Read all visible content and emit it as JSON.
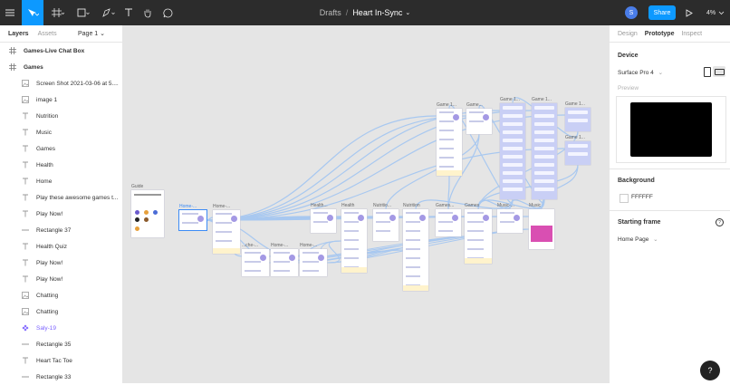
{
  "toolbar": {
    "breadcrumb_project": "Drafts",
    "breadcrumb_sep": "/",
    "file_name": "Heart In-Sync",
    "file_caret": "⌄",
    "avatar_letter": "S",
    "share_label": "Share",
    "zoom_label": "4%"
  },
  "left_panel": {
    "tab_layers": "Layers",
    "tab_assets": "Assets",
    "page_selector": "Page 1 ⌄",
    "layers": [
      {
        "name": "Games-Live Chat Box",
        "type": "frame",
        "level": 0
      },
      {
        "name": "Games",
        "type": "frame",
        "level": 0
      },
      {
        "name": "Screen Shot 2021-03-06 at 5....",
        "type": "image",
        "level": 1
      },
      {
        "name": "image 1",
        "type": "image",
        "level": 1
      },
      {
        "name": "Nutrition",
        "type": "text",
        "level": 1
      },
      {
        "name": "Music",
        "type": "text",
        "level": 1
      },
      {
        "name": "Games",
        "type": "text",
        "level": 1
      },
      {
        "name": "Health",
        "type": "text",
        "level": 1
      },
      {
        "name": "Home",
        "type": "text",
        "level": 1
      },
      {
        "name": "Play these awesome games t...",
        "type": "text",
        "level": 1
      },
      {
        "name": "Play Now!",
        "type": "text",
        "level": 1
      },
      {
        "name": "Rectangle 37",
        "type": "rect",
        "level": 1
      },
      {
        "name": "Health Quiz",
        "type": "text",
        "level": 1
      },
      {
        "name": "Play Now!",
        "type": "text",
        "level": 1
      },
      {
        "name": "Play Now!",
        "type": "text",
        "level": 1
      },
      {
        "name": "Chatting",
        "type": "image",
        "level": 1
      },
      {
        "name": "Chatting",
        "type": "image",
        "level": 1
      },
      {
        "name": "Saly-19",
        "type": "component",
        "level": 1
      },
      {
        "name": "Rectangle 35",
        "type": "rect",
        "level": 1
      },
      {
        "name": "Heart Tac Toe",
        "type": "text",
        "level": 1
      },
      {
        "name": "Rectangle 33",
        "type": "rect",
        "level": 1
      }
    ]
  },
  "canvas": {
    "frame_labels": [
      "Guide",
      "Home-...",
      "Home-...",
      "Health...",
      "Health",
      "Nutritio...",
      "Nutrition",
      "Games...",
      "Games",
      "Music-...",
      "Music",
      "Game 1...",
      "Game...",
      "Game 1...",
      "Game 1...",
      "Game 1...",
      "Game 1...",
      "...che-...",
      "Home-...",
      "Home-..."
    ],
    "colors": {
      "canvas_bg": "#e5e5e5",
      "connector": "#a8c8f0",
      "selection": "#3c8bf5",
      "hotspot": "#e4e8ff"
    }
  },
  "right_panel": {
    "tab_design": "Design",
    "tab_prototype": "Prototype",
    "tab_inspect": "Inspect",
    "device_title": "Device",
    "device_value": "Surface Pro 4",
    "preview_label": "Preview",
    "background_title": "Background",
    "background_value": "FFFFFF",
    "starting_frame_title": "Starting frame",
    "starting_frame_value": "Home Page"
  },
  "help_label": "?"
}
